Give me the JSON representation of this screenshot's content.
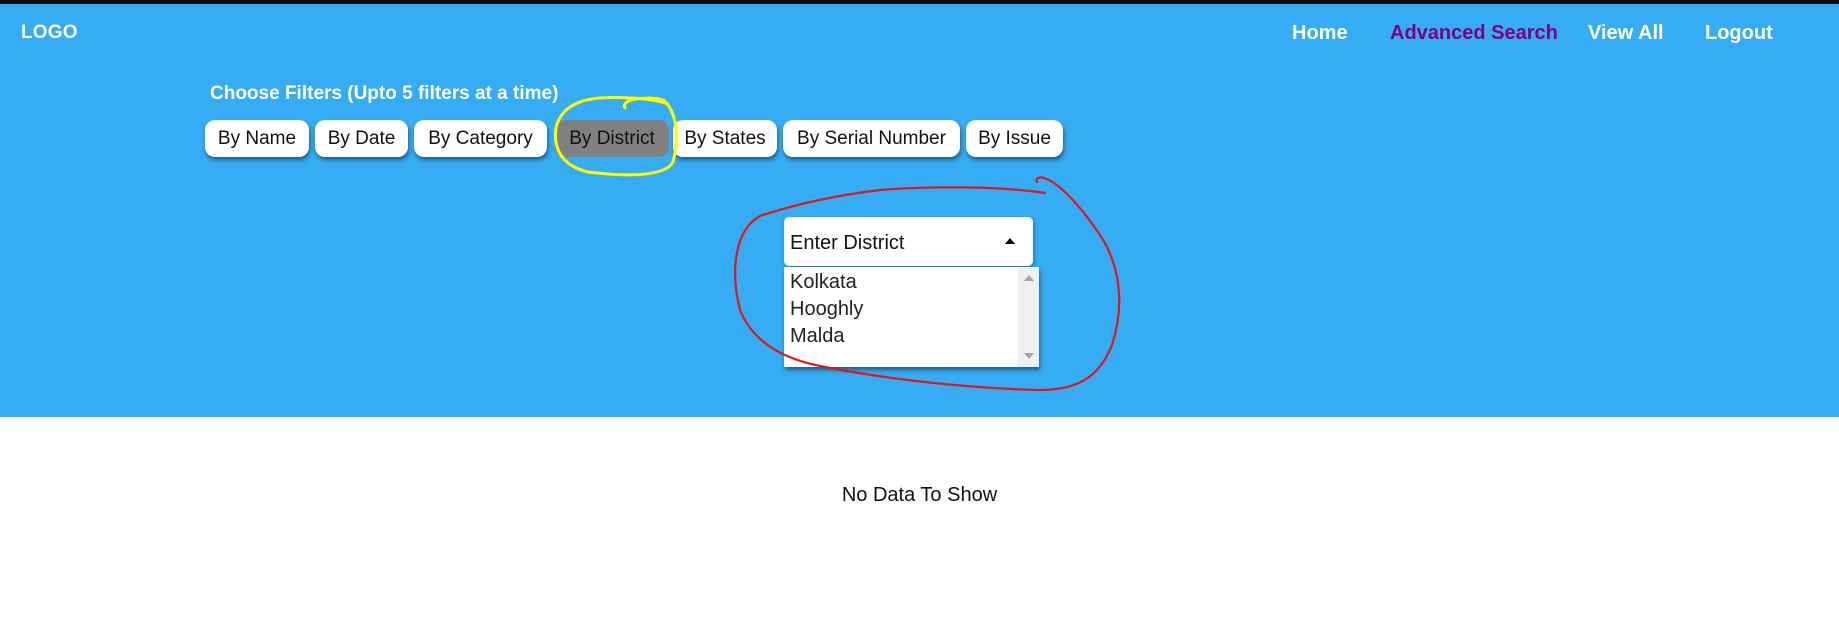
{
  "header": {
    "logo": "LOGO",
    "nav": [
      {
        "label": "Home",
        "active": false
      },
      {
        "label": "Advanced Search",
        "active": true
      },
      {
        "label": "View All",
        "active": false
      },
      {
        "label": "Logout",
        "active": false
      }
    ]
  },
  "filters": {
    "title": "Choose Filters (Upto 5 filters at a time)",
    "buttons": [
      {
        "label": "By Name",
        "selected": false
      },
      {
        "label": "By Date",
        "selected": false
      },
      {
        "label": "By Category",
        "selected": false
      },
      {
        "label": "By District",
        "selected": true
      },
      {
        "label": "By States",
        "selected": false
      },
      {
        "label": "By Serial Number",
        "selected": false
      },
      {
        "label": "By Issue",
        "selected": false
      }
    ]
  },
  "district_select": {
    "placeholder": "Enter District",
    "expanded": true,
    "options": [
      "Kolkata",
      "Hooghly",
      "Malda"
    ]
  },
  "results": {
    "empty_message": "No Data To Show"
  },
  "colors": {
    "hero_background": "#35acf4",
    "active_nav": "#800080",
    "selected_filter": "#808080",
    "annotation_yellow": "#ffff00",
    "annotation_red": "#e0161b"
  },
  "annotations": [
    {
      "type": "hand-drawn-circle",
      "color": "yellow",
      "target": "By District filter button"
    },
    {
      "type": "hand-drawn-circle",
      "color": "red",
      "target": "district dropdown"
    }
  ]
}
